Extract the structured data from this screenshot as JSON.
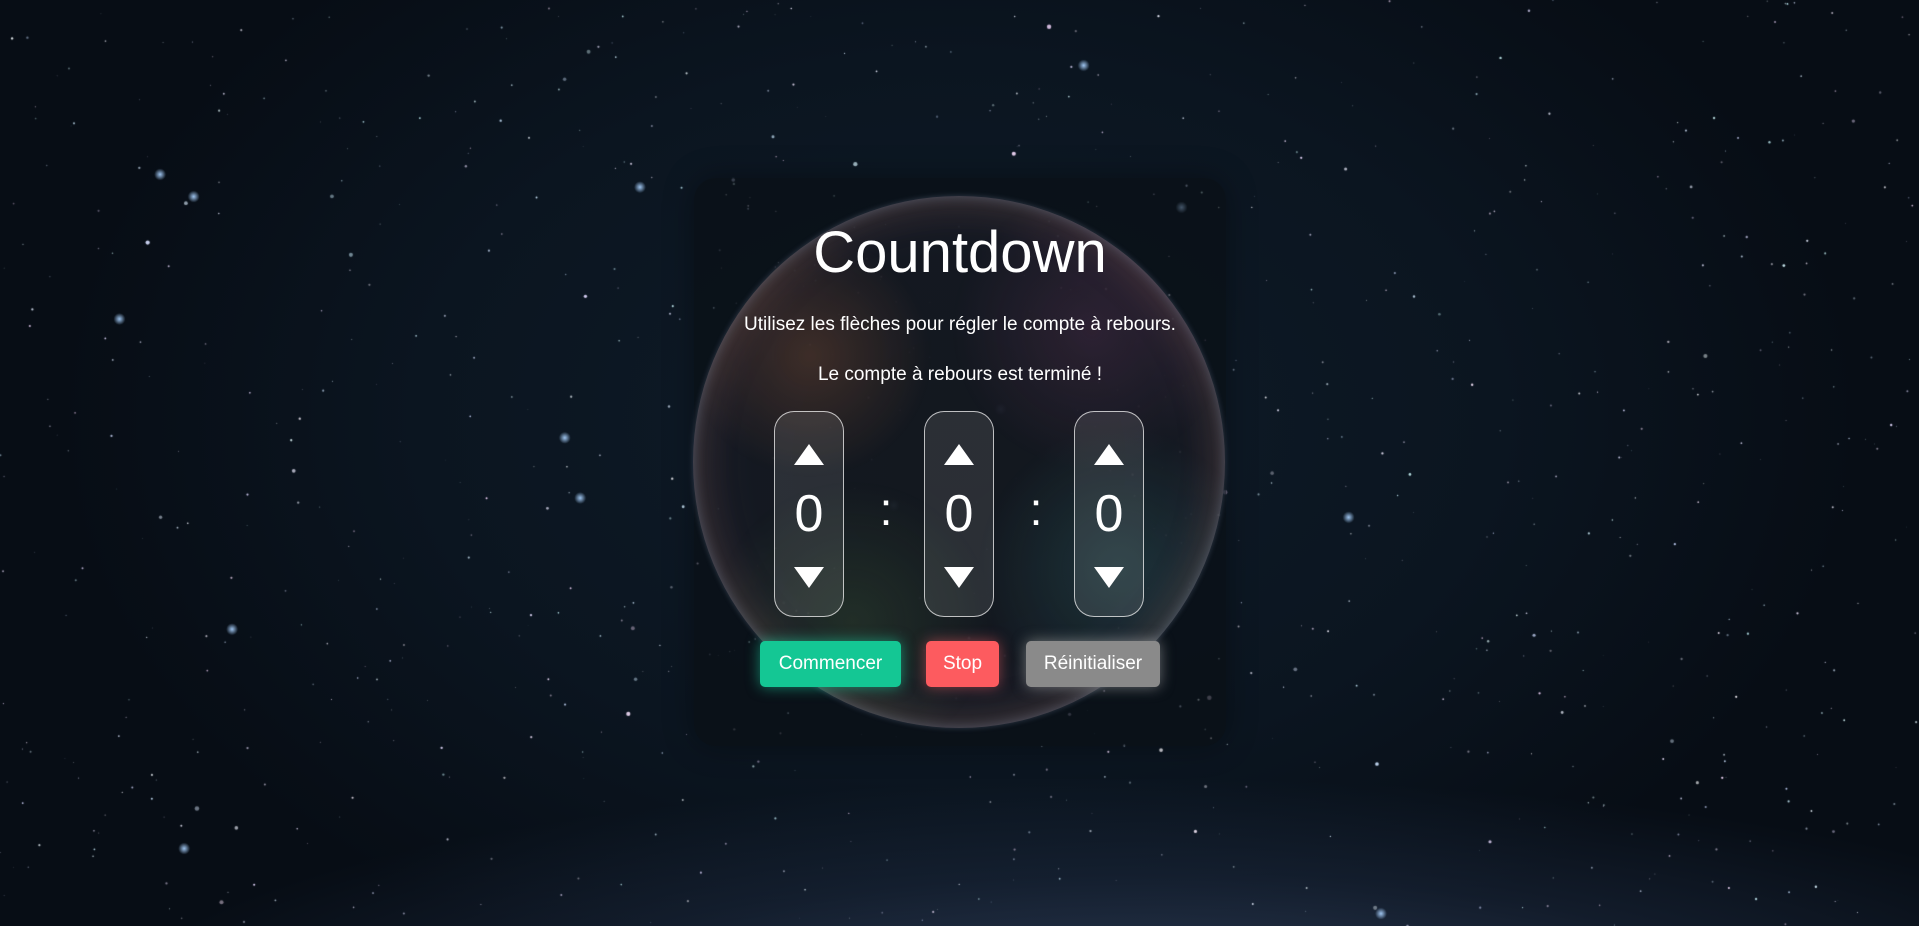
{
  "app": {
    "title": "Countdown",
    "instructions": "Utilisez les flèches pour régler le compte à rebours.",
    "status": "Le compte à rebours est terminé !"
  },
  "timer": {
    "hours": "0",
    "minutes": "0",
    "seconds": "0",
    "separator": ":"
  },
  "buttons": {
    "start_label": "Commencer",
    "stop_label": "Stop",
    "reset_label": "Réinitialiser"
  },
  "icons": {
    "increase": "arrow-up-icon",
    "decrease": "arrow-down-icon"
  },
  "colors": {
    "start": "#14c794",
    "stop": "#fd5b5f",
    "reset": "#8a8a8a",
    "text": "#ffffff"
  }
}
